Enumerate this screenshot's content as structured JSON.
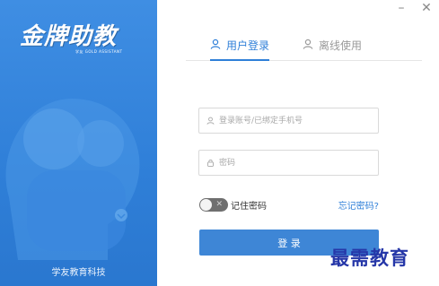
{
  "brand": {
    "logo_text": "金牌助教",
    "logo_subtitle": "学友 GOLD ASSISTANT",
    "company": "学友教育科技"
  },
  "window": {
    "minimize": "–",
    "close": "✕"
  },
  "tabs": [
    {
      "label": "用户登录",
      "active": true,
      "icon": "user-icon"
    },
    {
      "label": "离线使用",
      "active": false,
      "icon": "user-icon"
    }
  ],
  "form": {
    "account_placeholder": "登录账号/已绑定手机号",
    "account_value": "",
    "password_placeholder": "密码",
    "password_value": "",
    "remember_label": "记住密码",
    "remember_checked": false,
    "toggle_off_glyph": "✕",
    "forgot_label": "忘记密码?",
    "login_label": "登 录"
  },
  "watermark": "最需教育",
  "colors": {
    "accent": "#2f7fd8",
    "panel": "#3f8ee3",
    "button": "#3e86d6"
  }
}
